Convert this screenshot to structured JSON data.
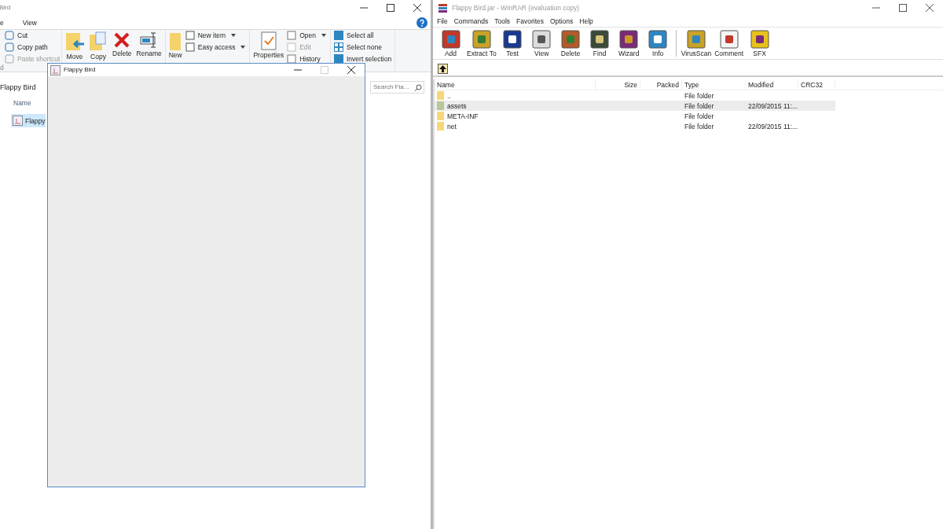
{
  "explorer": {
    "title": "Bird",
    "tabs": [
      {
        "label": "e",
        "selected": false
      },
      {
        "label": "View",
        "selected": false
      }
    ],
    "clipboard": [
      {
        "label": "Cut",
        "disabled": false
      },
      {
        "label": "Copy path",
        "disabled": false
      },
      {
        "label": "Paste shortcut",
        "disabled": true
      }
    ],
    "clipboard_group": "d",
    "organize": [
      {
        "label": "Move"
      },
      {
        "label": "Copy"
      },
      {
        "label": "Delete"
      },
      {
        "label": "Rename"
      }
    ],
    "new_big": "New",
    "new_small": [
      {
        "label": "New item",
        "dropdown": true
      },
      {
        "label": "Easy access",
        "dropdown": true
      }
    ],
    "properties": "Properties",
    "open_small": [
      {
        "label": "Open",
        "dropdown": true,
        "disabled": false
      },
      {
        "label": "Edit",
        "dropdown": false,
        "disabled": true
      },
      {
        "label": "History",
        "dropdown": false,
        "disabled": false
      }
    ],
    "select_small": [
      {
        "label": "Select all"
      },
      {
        "label": "Select none"
      },
      {
        "label": "Invert selection"
      }
    ],
    "address": "Flappy Bird",
    "search": {
      "placeholder": "Search Fla..."
    },
    "column": "Name",
    "files": [
      {
        "name": "Flappy",
        "selected": true
      }
    ]
  },
  "java_window": {
    "title": "Flappy Bird"
  },
  "winrar": {
    "title": "Flappy Bird.jar - WinRAR (evaluation copy)",
    "menu": [
      "File",
      "Commands",
      "Tools",
      "Favorites",
      "Options",
      "Help"
    ],
    "toolbar": [
      "Add",
      "Extract To",
      "Test",
      "View",
      "Delete",
      "Find",
      "Wizard",
      "Info",
      "VirusScan",
      "Comment",
      "SFX"
    ],
    "columns": [
      "Name",
      "Size",
      "Packed",
      "Type",
      "Modified",
      "CRC32"
    ],
    "rows": [
      {
        "name": "..",
        "size": "",
        "packed": "",
        "type": "File folder",
        "modified": "",
        "selected": false
      },
      {
        "name": "assets",
        "size": "",
        "packed": "",
        "type": "File folder",
        "modified": "22/09/2015 11:...",
        "selected": true
      },
      {
        "name": "META-INF",
        "size": "",
        "packed": "",
        "type": "File folder",
        "modified": "",
        "selected": false
      },
      {
        "name": "net",
        "size": "",
        "packed": "",
        "type": "File folder",
        "modified": "22/09/2015 11:...",
        "selected": false
      }
    ]
  }
}
